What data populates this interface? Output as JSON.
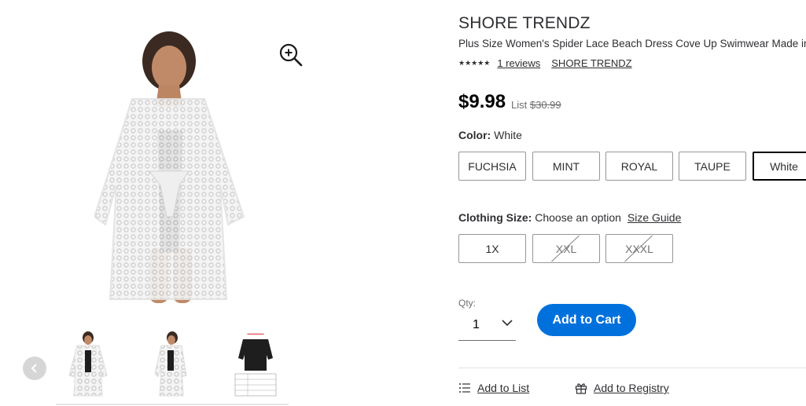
{
  "gallery": {
    "zoom_icon": "zoom-in-icon",
    "prev_icon": "chevron-left-icon"
  },
  "product": {
    "brand": "SHORE TRENDZ",
    "title": "Plus Size Women's Spider Lace Beach Dress Cove Up Swimwear Made in U",
    "stars_text": "★★★★★",
    "reviews": "1 reviews",
    "brand_link": "SHORE TRENDZ",
    "price": "$9.98",
    "list_label": "List",
    "list_price": "$30.99"
  },
  "color": {
    "label": "Color:",
    "selected": "White",
    "options": [
      "FUCHSIA",
      "MINT",
      "ROYAL",
      "TAUPE",
      "White"
    ]
  },
  "size": {
    "label": "Clothing Size:",
    "prompt": "Choose an option",
    "guide": "Size Guide",
    "options": [
      "1X",
      "XXL",
      "XXXL"
    ]
  },
  "quantity": {
    "label": "Qty:",
    "value": "1"
  },
  "cart": {
    "label": "Add to Cart",
    "color": "#0071dc"
  },
  "actions": {
    "list": "Add to List",
    "registry": "Add to Registry"
  }
}
